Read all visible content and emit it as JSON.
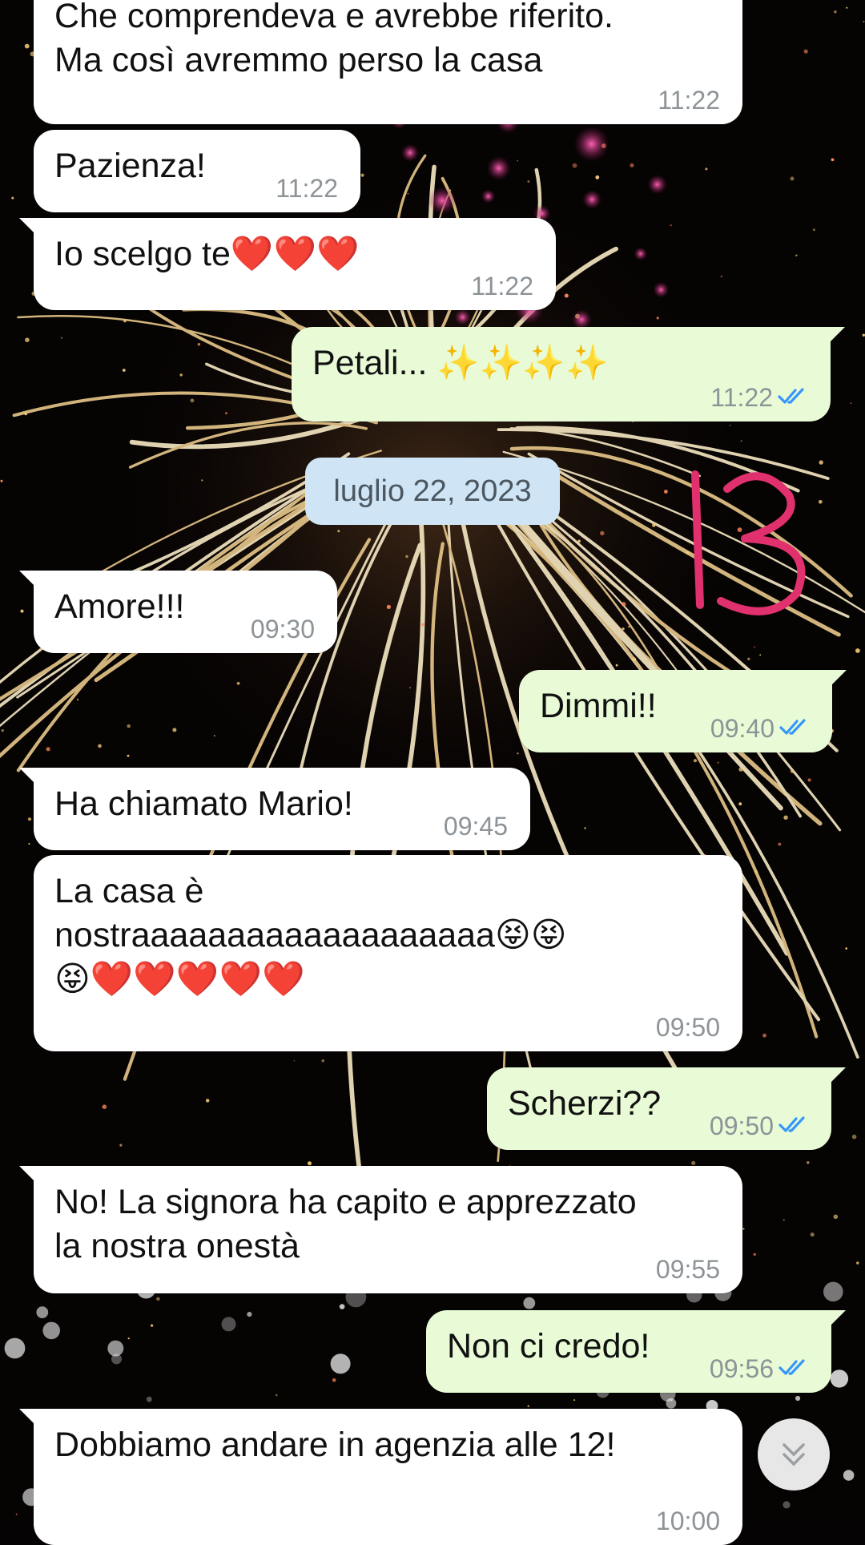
{
  "chat": {
    "date_separator": "luglio 22, 2023",
    "annotation_mark": "13",
    "messages": [
      {
        "text": "Che comprendeva e avrebbe riferito.\nMa così avremmo perso la casa",
        "time": "11:22",
        "direction": "in"
      },
      {
        "text": "Pazienza!",
        "time": "11:22",
        "direction": "in"
      },
      {
        "text": "Io scelgo te❤️❤️❤️",
        "time": "11:22",
        "direction": "in"
      },
      {
        "text": "Petali... ✨✨✨✨",
        "time": "11:22",
        "direction": "out",
        "read": true
      },
      {
        "text": "Amore!!!",
        "time": "09:30",
        "direction": "in"
      },
      {
        "text": "Dimmi!!",
        "time": "09:40",
        "direction": "out",
        "read": true
      },
      {
        "text": "Ha chiamato Mario!",
        "time": "09:45",
        "direction": "in"
      },
      {
        "text": "La casa è\nnostraaaaaaaaaaaaaaaaaaa😝😝\n😝❤️❤️❤️❤️❤️",
        "time": "09:50",
        "direction": "in"
      },
      {
        "text": "Scherzi??",
        "time": "09:50",
        "direction": "out",
        "read": true
      },
      {
        "text": "No! La signora ha capito e apprezzato\nla nostra onestà",
        "time": "09:55",
        "direction": "in"
      },
      {
        "text": "Non ci credo!",
        "time": "09:56",
        "direction": "out",
        "read": true
      },
      {
        "text": "Dobbiamo andare in agenzia alle 12!",
        "time": "10:00",
        "direction": "in"
      }
    ]
  },
  "colors": {
    "incoming_bubble": "#ffffff",
    "outgoing_bubble": "#e8fbd6",
    "read_tick": "#3497f9",
    "annotation": "#e0306e",
    "date_chip": "#cfe5f5"
  },
  "icons": {
    "scroll_down": "double-chevron-down-icon",
    "read_receipt": "double-check-icon"
  }
}
